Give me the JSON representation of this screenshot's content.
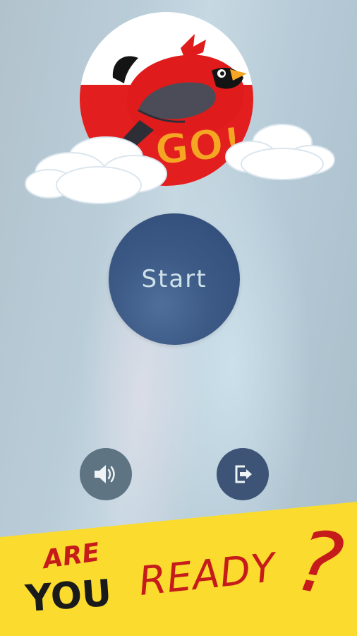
{
  "logo": {
    "badge_text": "GO!",
    "colors": {
      "red": "#e41b1b",
      "orange": "#f5a623",
      "white": "#ffffff"
    }
  },
  "main": {
    "start_label": "Start"
  },
  "controls": {
    "sound_icon": "speaker-volume-icon",
    "exit_icon": "exit-door-icon"
  },
  "banner": {
    "line1": "ARE",
    "line2": "YOU",
    "line3": "READY",
    "punctuation": "?",
    "colors": {
      "background": "#fadb2e",
      "red": "#c61b1b",
      "black": "#1a1a1a"
    }
  }
}
